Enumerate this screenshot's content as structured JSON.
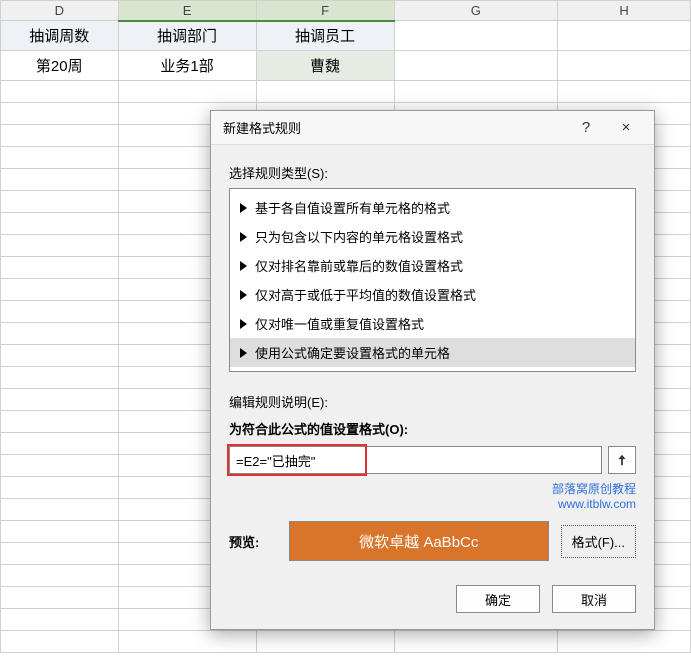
{
  "columns": [
    "D",
    "E",
    "F",
    "G",
    "H"
  ],
  "grid": {
    "header": {
      "D": "抽调周数",
      "E": "抽调部门",
      "F": "抽调员工"
    },
    "row": {
      "D": "第20周",
      "E": "业务1部",
      "F": "曹魏"
    }
  },
  "dialog": {
    "title": "新建格式规则",
    "help_char": "?",
    "close_char": "×",
    "select_type_label": "选择规则类型(S):",
    "rule_types": [
      "基于各自值设置所有单元格的格式",
      "只为包含以下内容的单元格设置格式",
      "仅对排名靠前或靠后的数值设置格式",
      "仅对高于或低于平均值的数值设置格式",
      "仅对唯一值或重复值设置格式",
      "使用公式确定要设置格式的单元格"
    ],
    "edit_desc_label": "编辑规则说明(E):",
    "formula_label": "为符合此公式的值设置格式(O):",
    "formula_value": "=E2=\"已抽完\"",
    "credit_line1": "部落窝原创教程",
    "credit_line2": "www.itblw.com",
    "preview_label": "预览:",
    "preview_sample": "微软卓越 AaBbCc",
    "format_button": "格式(F)...",
    "ok": "确定",
    "cancel": "取消"
  }
}
